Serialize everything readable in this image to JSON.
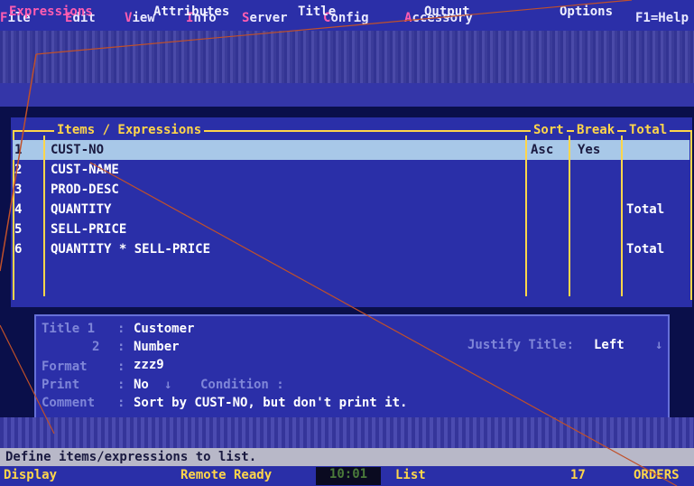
{
  "menu": {
    "items": [
      {
        "hot": "F",
        "rest": "ile"
      },
      {
        "hot": "E",
        "rest": "dit"
      },
      {
        "hot": "V",
        "rest": "iew"
      },
      {
        "hot": "I",
        "rest": "nfo"
      },
      {
        "hot": "S",
        "rest": "erver"
      },
      {
        "hot": "C",
        "rest": "onfig"
      },
      {
        "hot": "A",
        "rest": "ccessory"
      }
    ],
    "help": "F1=Help"
  },
  "tabs": {
    "expressions": "Expressions",
    "attributes": "Attributes",
    "title": "Title",
    "output": "Output",
    "options": "Options"
  },
  "grid": {
    "headers": {
      "items": "Items / Expressions",
      "sort": "Sort",
      "break": "Break",
      "total": "Total"
    },
    "rows": [
      {
        "num": "1",
        "expr": "CUST-NO",
        "sort": "Asc",
        "break": "Yes",
        "total": ""
      },
      {
        "num": "2",
        "expr": "CUST-NAME",
        "sort": "",
        "break": "",
        "total": ""
      },
      {
        "num": "3",
        "expr": "PROD-DESC",
        "sort": "",
        "break": "",
        "total": ""
      },
      {
        "num": "4",
        "expr": "QUANTITY",
        "sort": "",
        "break": "",
        "total": "Total"
      },
      {
        "num": "5",
        "expr": "SELL-PRICE",
        "sort": "",
        "break": "",
        "total": ""
      },
      {
        "num": "6",
        "expr": "QUANTITY * SELL-PRICE",
        "sort": "",
        "break": "",
        "total": "Total"
      }
    ]
  },
  "detail": {
    "title1_label": "Title 1",
    "title1_value": "Customer",
    "title2_label": "2",
    "title2_value": "Number",
    "format_label": "Format",
    "format_value": "zzz9",
    "print_label": "Print",
    "print_value": "No",
    "condition_label": "Condition :",
    "comment_label": "Comment",
    "comment_value": "Sort by CUST-NO, but don't print it.",
    "justify_label": "Justify Title:",
    "justify_value": "Left"
  },
  "message": "Define items/expressions to list.",
  "status": {
    "mode": "Display",
    "remote": "Remote Ready",
    "clock": "10:01",
    "view": "List",
    "count": "17",
    "table": "ORDERS"
  },
  "colors": {
    "background": "#2a2fa8",
    "hotkey": "#ff5db1",
    "frame": "#ffd64a",
    "selection": "#a8c8e8"
  }
}
